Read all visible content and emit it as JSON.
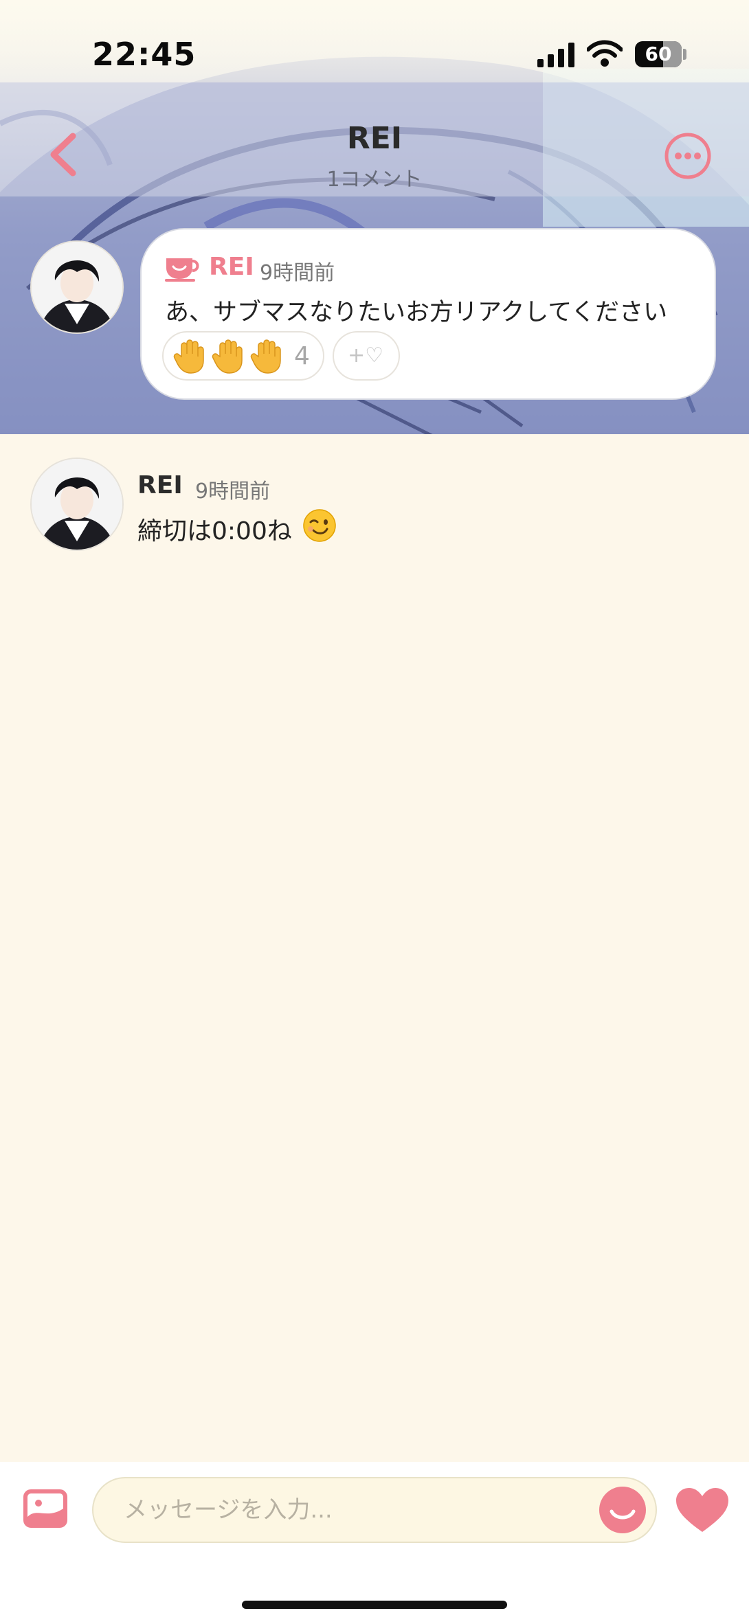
{
  "status_bar": {
    "time": "22:45",
    "battery": "60",
    "battery_level_percent": 60
  },
  "header": {
    "title": "REI",
    "subtitle": "1コメント",
    "back_icon": "chevron-left-icon",
    "more_icon": "more-horizontal-icon"
  },
  "pinned_message": {
    "author": "REI",
    "time": "9時間前",
    "text": "あ、サブマスなりたいお方リアクしてください",
    "badge_icon": "cup-icon",
    "reaction": {
      "icon": "raised-hand-icon",
      "count": "4"
    },
    "add_reaction_label": "+♡"
  },
  "messages": [
    {
      "author": "REI",
      "time": "9時間前",
      "text": "締切は0:00ね",
      "emoji_icon": "winking-face-icon"
    }
  ],
  "composer": {
    "placeholder": "メッセージを入力...",
    "image_icon": "image-icon",
    "emoji_icon": "emoji-face-icon",
    "like_icon": "heart-icon"
  },
  "colors": {
    "accent": "#ef7f8e",
    "background": "#fdf7ea",
    "input_background": "#fdf7e3"
  }
}
